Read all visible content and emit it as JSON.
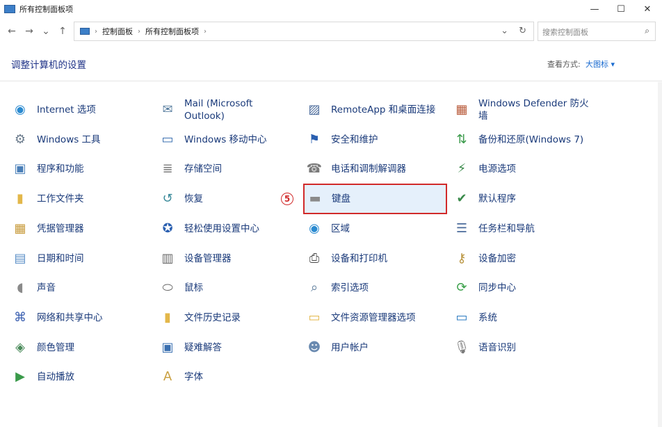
{
  "window": {
    "title": "所有控制面板项",
    "minimize": "—",
    "maximize": "☐",
    "close": "✕"
  },
  "nav": {
    "back": "←",
    "forward": "→",
    "recent": "⌄",
    "up": "↑",
    "dropdown": "⌄",
    "refresh": "↻"
  },
  "breadcrumb": {
    "sep1": "›",
    "item1": "控制面板",
    "sep2": "›",
    "item2": "所有控制面板项",
    "sep3": "›"
  },
  "search": {
    "placeholder": "搜索控制面板",
    "icon": "⌕"
  },
  "header": {
    "title": "调整计算机的设置",
    "view_by_label": "查看方式:",
    "view_by_value": "大图标 ▾"
  },
  "annotation": {
    "badge": "5"
  },
  "items": [
    [
      {
        "label": "Internet 选项",
        "icon": "globe-icon",
        "glyph": "◉",
        "color": "#2a8ad0"
      },
      {
        "label": "Windows 工具",
        "icon": "gear-icon",
        "glyph": "⚙",
        "color": "#6b7b8c"
      },
      {
        "label": "程序和功能",
        "icon": "programs-icon",
        "glyph": "▣",
        "color": "#4a7fb8"
      },
      {
        "label": "工作文件夹",
        "icon": "folder-icon",
        "glyph": "▮",
        "color": "#e3b74a"
      },
      {
        "label": "凭据管理器",
        "icon": "safe-icon",
        "glyph": "▦",
        "color": "#c79a3a"
      },
      {
        "label": "日期和时间",
        "icon": "calendar-icon",
        "glyph": "▤",
        "color": "#5b8fc7"
      },
      {
        "label": "声音",
        "icon": "speaker-icon",
        "glyph": "◖",
        "color": "#8a8a8a"
      },
      {
        "label": "网络和共享中心",
        "icon": "network-icon",
        "glyph": "⌘",
        "color": "#3a5fb0"
      },
      {
        "label": "颜色管理",
        "icon": "color-icon",
        "glyph": "◈",
        "color": "#4a8a5a"
      },
      {
        "label": "自动播放",
        "icon": "autoplay-icon",
        "glyph": "▶",
        "color": "#3a9a4a"
      }
    ],
    [
      {
        "label": "Mail (Microsoft Outlook)",
        "icon": "mail-icon",
        "glyph": "✉",
        "color": "#5a7fa0"
      },
      {
        "label": "Windows 移动中心",
        "icon": "mobility-icon",
        "glyph": "▭",
        "color": "#3a6fb0"
      },
      {
        "label": "存储空间",
        "icon": "storage-icon",
        "glyph": "≣",
        "color": "#7a7a7a"
      },
      {
        "label": "恢复",
        "icon": "recovery-icon",
        "glyph": "↺",
        "color": "#3a8a9a"
      },
      {
        "label": "轻松使用设置中心",
        "icon": "ease-icon",
        "glyph": "✪",
        "color": "#2a5fb0"
      },
      {
        "label": "设备管理器",
        "icon": "device-manager-icon",
        "glyph": "▥",
        "color": "#6a6a6a"
      },
      {
        "label": "鼠标",
        "icon": "mouse-icon",
        "glyph": "⬭",
        "color": "#6a6a6a"
      },
      {
        "label": "文件历史记录",
        "icon": "file-history-icon",
        "glyph": "▮",
        "color": "#e3b74a"
      },
      {
        "label": "疑难解答",
        "icon": "troubleshoot-icon",
        "glyph": "▣",
        "color": "#3a6fb0"
      },
      {
        "label": "字体",
        "icon": "fonts-icon",
        "glyph": "A",
        "color": "#c9a040"
      }
    ],
    [
      {
        "label": "RemoteApp 和桌面连接",
        "icon": "remoteapp-icon",
        "glyph": "▨",
        "color": "#4a6a9a"
      },
      {
        "label": "安全和维护",
        "icon": "flag-icon",
        "glyph": "⚑",
        "color": "#2a5fb0"
      },
      {
        "label": "电话和调制解调器",
        "icon": "phone-icon",
        "glyph": "☎",
        "color": "#7a7a7a"
      },
      {
        "label": "键盘",
        "icon": "keyboard-icon",
        "glyph": "▬",
        "color": "#8a8a8a"
      },
      {
        "label": "区域",
        "icon": "region-icon",
        "glyph": "◉",
        "color": "#2a8ad0"
      },
      {
        "label": "设备和打印机",
        "icon": "printer-icon",
        "glyph": "⎙",
        "color": "#4a4a4a"
      },
      {
        "label": "索引选项",
        "icon": "index-icon",
        "glyph": "⌕",
        "color": "#5a7a9a"
      },
      {
        "label": "文件资源管理器选项",
        "icon": "explorer-options-icon",
        "glyph": "▭",
        "color": "#e3b74a"
      },
      {
        "label": "用户帐户",
        "icon": "users-icon",
        "glyph": "☻",
        "color": "#6a8ab0"
      }
    ],
    [
      {
        "label": "Windows Defender 防火墙",
        "icon": "firewall-icon",
        "glyph": "▦",
        "color": "#b85a3a"
      },
      {
        "label": "备份和还原(Windows 7)",
        "icon": "backup-icon",
        "glyph": "⇅",
        "color": "#3a9a4a"
      },
      {
        "label": "电源选项",
        "icon": "power-icon",
        "glyph": "⚡",
        "color": "#3a8a4a"
      },
      {
        "label": "默认程序",
        "icon": "default-programs-icon",
        "glyph": "✔",
        "color": "#3a8a4a"
      },
      {
        "label": "任务栏和导航",
        "icon": "taskbar-icon",
        "glyph": "☰",
        "color": "#4a6a9a"
      },
      {
        "label": "设备加密",
        "icon": "encryption-icon",
        "glyph": "⚷",
        "color": "#b8923a"
      },
      {
        "label": "同步中心",
        "icon": "sync-icon",
        "glyph": "⟳",
        "color": "#3aa04a"
      },
      {
        "label": "系统",
        "icon": "system-icon",
        "glyph": "▭",
        "color": "#2a7ac0"
      },
      {
        "label": "语音识别",
        "icon": "microphone-icon",
        "glyph": "🎙",
        "color": "#7a7a7a"
      }
    ]
  ]
}
